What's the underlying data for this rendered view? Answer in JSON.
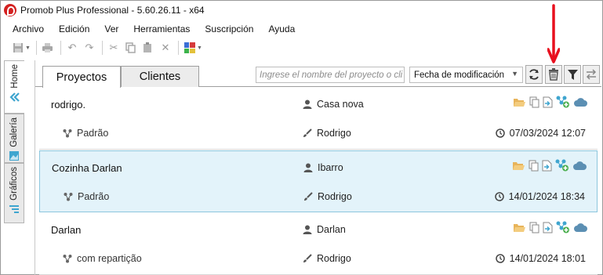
{
  "window": {
    "title": "Promob Plus Professional - 5.60.26.11 - x64"
  },
  "menu": [
    "Archivo",
    "Edición",
    "Ver",
    "Herramientas",
    "Suscripción",
    "Ayuda"
  ],
  "side_tabs": [
    "Home",
    "Galería",
    "Gráficos"
  ],
  "tabs": [
    "Proyectos",
    "Clientes"
  ],
  "search": {
    "placeholder": "Ingrese el nombre del proyecto o cli",
    "value": ""
  },
  "sort": {
    "selected": "Fecha de modificación"
  },
  "projects": [
    {
      "name": "rodrigo.",
      "client": "Casa nova",
      "version": "Padrão",
      "author": "Rodrigo",
      "date": "07/03/2024 12:07"
    },
    {
      "name": "Cozinha Darlan",
      "client": "Ibarro",
      "version": "Padrão",
      "author": "Rodrigo",
      "date": "14/01/2024 18:34"
    },
    {
      "name": "Darlan",
      "client": "Darlan",
      "version": "com repartição",
      "author": "Rodrigo",
      "date": "14/01/2024 18:01"
    }
  ],
  "icons": {
    "folder": "folder-open-icon",
    "copy": "copy-icon",
    "export": "export-icon",
    "share": "share-network-icon",
    "cloud": "cloud-icon",
    "refresh": "refresh-icon",
    "delete": "trash-icon",
    "filter": "filter-icon",
    "swap": "swap-icon"
  },
  "colors": {
    "accent": "#3fa5cf",
    "selected_row": "#e3f3fa",
    "annotation_arrow": "#e8101f",
    "folder": "#e8b45a"
  }
}
